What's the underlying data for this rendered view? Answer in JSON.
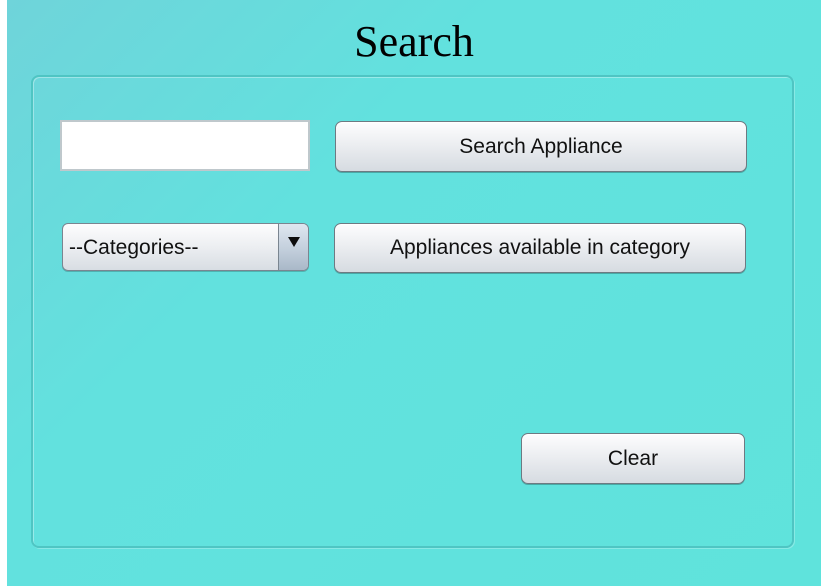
{
  "window": {
    "title": "Search"
  },
  "search": {
    "input_value": "",
    "button_label": "Search Appliance"
  },
  "category": {
    "selected": "--Categories--",
    "button_label": "Appliances available in category",
    "arrow_icon": "chevron-down-icon"
  },
  "actions": {
    "clear_label": "Clear"
  },
  "colors": {
    "background": "#5fe3dc",
    "panel_border": "#4fc5c3"
  }
}
